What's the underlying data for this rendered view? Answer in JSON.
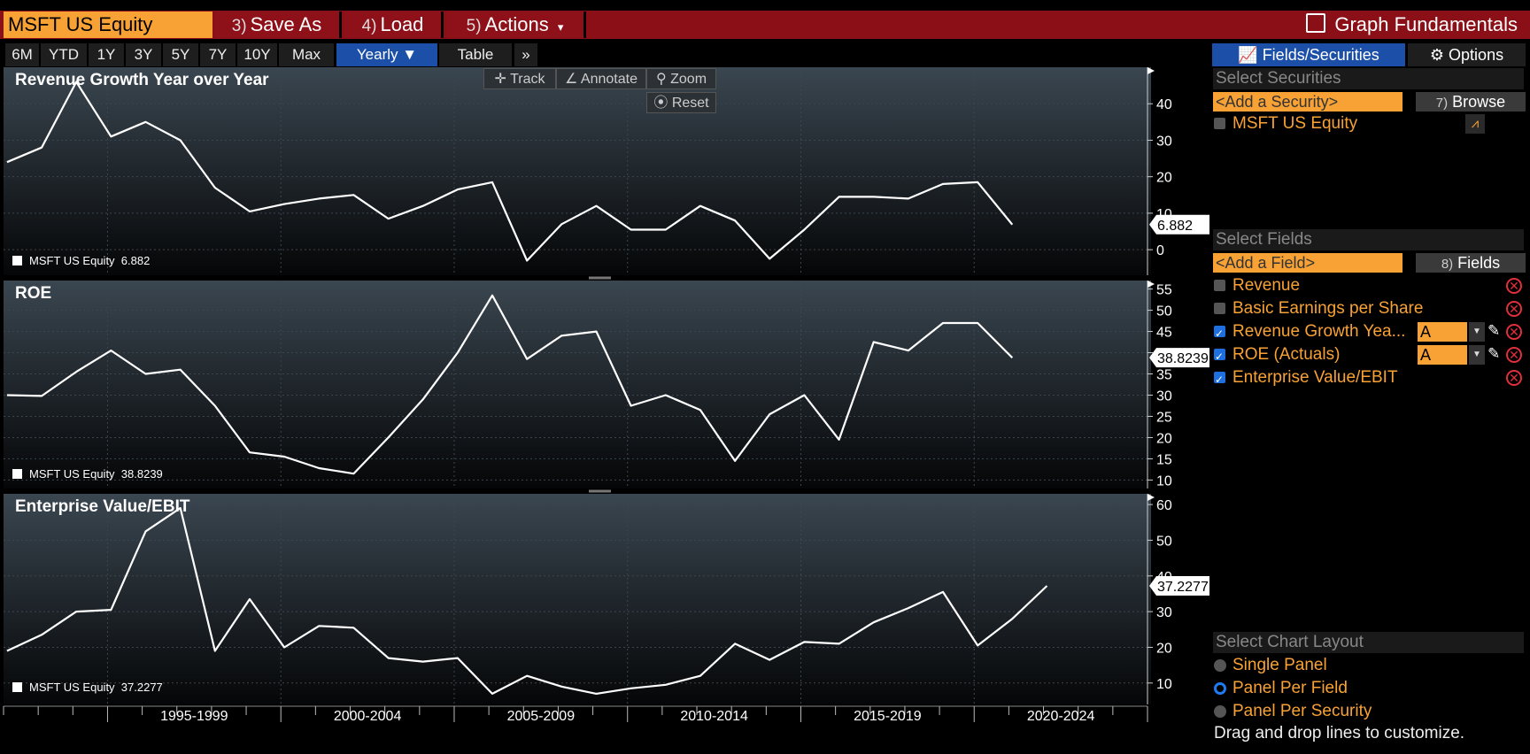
{
  "toolbar": {
    "ticker": "MSFT US Equity",
    "save_num": "3)",
    "save_label": "Save As",
    "load_num": "4)",
    "load_label": "Load",
    "actions_num": "5)",
    "actions_label": "Actions",
    "actions_caret": "▾",
    "graph_title": "Graph Fundamentals"
  },
  "ranges": [
    "6M",
    "YTD",
    "1Y",
    "3Y",
    "5Y",
    "7Y",
    "10Y",
    "Max"
  ],
  "period": "Yearly ▼",
  "table_label": "Table",
  "more_label": "»",
  "chart_tools": {
    "track": "Track",
    "annotate": "Annotate",
    "zoom": "Zoom",
    "reset": "Reset"
  },
  "side": {
    "tab_fields": "Fields/Securities",
    "tab_options": "Options",
    "select_securities": "Select Securities",
    "add_security": "<Add a Security>",
    "browse_num": "7)",
    "browse": "Browse",
    "security": "MSFT US Equity",
    "select_fields": "Select Fields",
    "add_field": "<Add a Field>",
    "fields_num": "8)",
    "fields_btn": "Fields",
    "fields": [
      {
        "label": "Revenue",
        "checked": false
      },
      {
        "label": "Basic Earnings per Share",
        "checked": false
      },
      {
        "label": "Revenue Growth Yea...",
        "checked": true,
        "axis": "A"
      },
      {
        "label": "ROE (Actuals)",
        "checked": true,
        "axis": "A"
      },
      {
        "label": "Enterprise Value/EBIT",
        "checked": true
      }
    ],
    "select_layout": "Select Chart Layout",
    "layouts": [
      {
        "label": "Single Panel",
        "selected": false
      },
      {
        "label": "Panel Per Field",
        "selected": true
      },
      {
        "label": "Panel Per Security",
        "selected": false
      }
    ],
    "hint": "Drag and drop lines to customize."
  },
  "chart_data": [
    {
      "type": "line",
      "title": "Revenue Growth Year over Year",
      "series_name": "MSFT US Equity",
      "last_value": "6.882",
      "x": [
        1993,
        1994,
        1995,
        1996,
        1997,
        1998,
        1999,
        2000,
        2001,
        2002,
        2003,
        2004,
        2005,
        2006,
        2007,
        2008,
        2009,
        2010,
        2011,
        2012,
        2013,
        2014,
        2015,
        2016,
        2017,
        2018,
        2019,
        2020,
        2021,
        2022,
        2023,
        2024
      ],
      "values": [
        24,
        28,
        46,
        31,
        35,
        30,
        17,
        10.5,
        12.5,
        14,
        15,
        8.5,
        12,
        16.5,
        18.5,
        -3,
        7,
        12,
        5.5,
        5.5,
        12,
        8,
        -2.5,
        5.5,
        14.5,
        14.5,
        14,
        18,
        18.5,
        6.882
      ],
      "x_from": 1992,
      "ylim": [
        -7,
        50
      ],
      "yticks": [
        0,
        10,
        20,
        30,
        40
      ]
    },
    {
      "type": "line",
      "title": "ROE",
      "series_name": "MSFT US Equity",
      "last_value": "38.8239",
      "x_from": 1992,
      "values": [
        30,
        29.8,
        35.5,
        40.5,
        35,
        36,
        27.5,
        16.5,
        15.5,
        12.8,
        11.5,
        20,
        29,
        40,
        53.5,
        38.5,
        44,
        45,
        27.5,
        30,
        26.5,
        14.5,
        25.5,
        30,
        19.5,
        42.5,
        40.5,
        47,
        47,
        38.8239
      ],
      "ylim": [
        8,
        57
      ],
      "yticks": [
        10,
        15,
        20,
        25,
        30,
        35,
        40,
        45,
        50,
        55
      ]
    },
    {
      "type": "line",
      "title": "Enterprise Value/EBIT",
      "series_name": "MSFT US Equity",
      "last_value": "37.2277",
      "x_from": 1992,
      "values": [
        19,
        23.5,
        30,
        30.5,
        52.5,
        59,
        19,
        33.5,
        20,
        26,
        25.5,
        17,
        16,
        17,
        7,
        12,
        9,
        7,
        8.5,
        9.5,
        12,
        21,
        16.5,
        21.5,
        21,
        27,
        31,
        35.5,
        20.5,
        28,
        37.2277
      ],
      "ylim": [
        4,
        63
      ],
      "yticks": [
        10,
        20,
        30,
        40,
        50,
        60
      ]
    }
  ],
  "x_axis": {
    "labels": [
      "1995-1999",
      "2000-2004",
      "2005-2009",
      "2010-2014",
      "2015-2019",
      "2020-2024"
    ]
  }
}
